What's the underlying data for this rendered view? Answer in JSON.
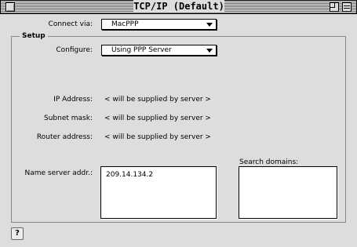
{
  "window": {
    "title": "TCP/IP (Default)"
  },
  "connect": {
    "label": "Connect via:",
    "value": "MacPPP"
  },
  "setup": {
    "group_title": "Setup",
    "configure_label": "Configure:",
    "configure_value": "Using PPP Server",
    "ip_label": "IP Address:",
    "ip_value": "< will be supplied by server >",
    "subnet_label": "Subnet mask:",
    "subnet_value": "< will be supplied by server >",
    "router_label": "Router address:",
    "router_value": "< will be supplied by server >",
    "nameserver_label": "Name server addr.:",
    "nameserver_value": "209.14.134.2",
    "search_label": "Search domains:",
    "search_value": ""
  },
  "help": {
    "glyph": "?"
  },
  "icons": {
    "close": "close-box-icon",
    "zoom": "zoom-box-icon",
    "collapse": "collapse-box-icon",
    "popup_arrow": "triangle-down-icon",
    "help": "help-icon"
  }
}
